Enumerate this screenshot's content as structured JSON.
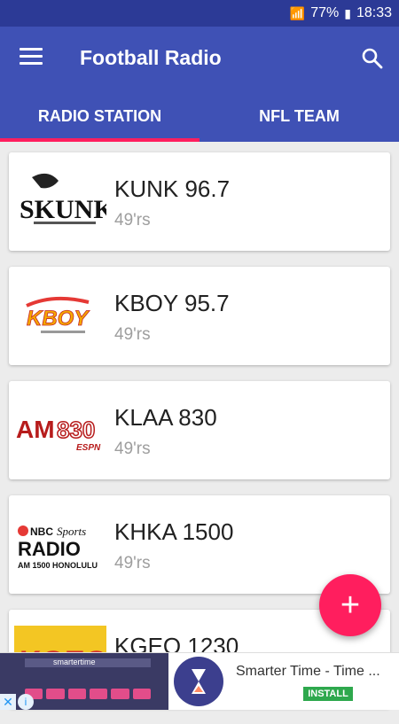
{
  "status_bar": {
    "battery": "77%",
    "time": "18:33"
  },
  "app_bar": {
    "title": "Football Radio",
    "menu_icon": "menu-icon",
    "search_icon": "search-icon"
  },
  "tabs": [
    {
      "label": "RADIO STATION",
      "active": true
    },
    {
      "label": "NFL TEAM",
      "active": false
    }
  ],
  "stations": [
    {
      "name": "KUNK 96.7",
      "team": "49'rs",
      "logo": "skunk-logo"
    },
    {
      "name": "KBOY 95.7",
      "team": "49'rs",
      "logo": "kboy-logo"
    },
    {
      "name": "KLAA 830",
      "team": "49'rs",
      "logo": "am830-logo"
    },
    {
      "name": "KHKA 1500",
      "team": "49'rs",
      "logo": "nbc-sports-radio-logo"
    },
    {
      "name": "KGEO 1230",
      "team": "",
      "logo": "kgeo-logo"
    }
  ],
  "fab": {
    "icon": "plus-icon",
    "label": "+"
  },
  "ad": {
    "app_title": "Smarter Time - Time ...",
    "install_label": "INSTALL",
    "thumb_text": "smartertime",
    "close_label": "✕",
    "info_label": "i"
  },
  "colors": {
    "primary": "#3f51b5",
    "status_bar": "#2c3a96",
    "accent": "#ff1e5e"
  }
}
